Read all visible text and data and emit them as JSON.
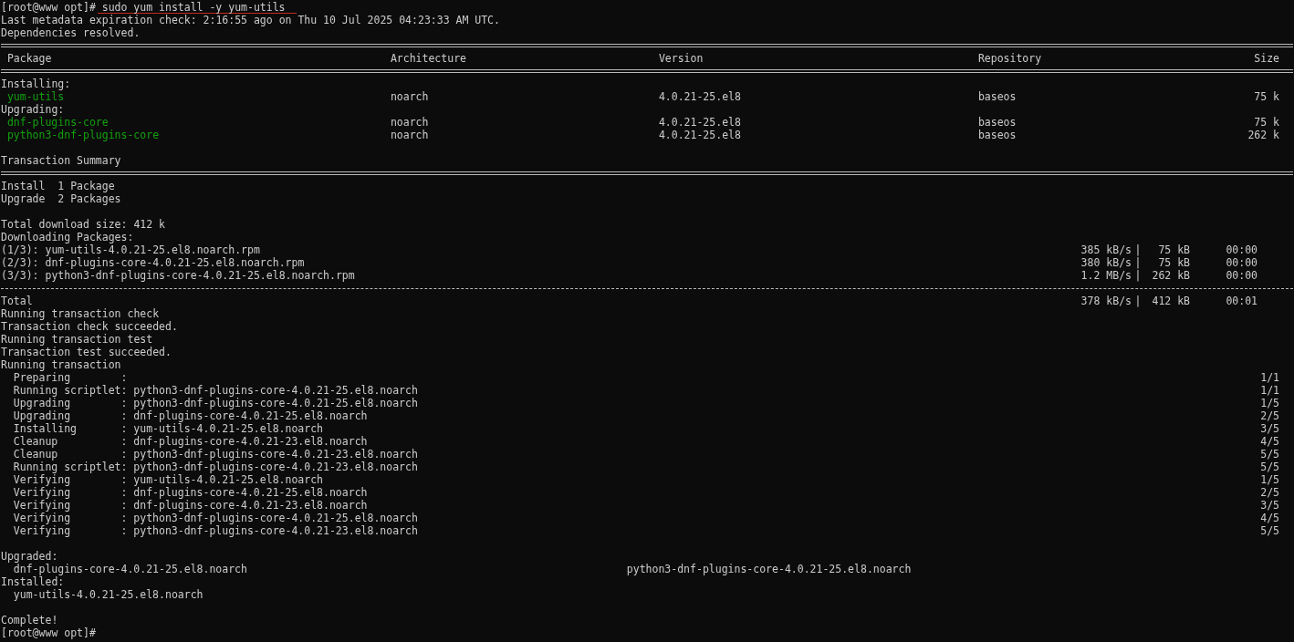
{
  "terminal": {
    "lines": [
      {
        "kind": "prompt",
        "prompt": "[root@www opt]#",
        "command": "sudo yum install -y yum-utils",
        "underlined": true
      },
      {
        "kind": "text",
        "text": "Last metadata expiration check: 2:16:55 ago on Thu 10 Jul 2025 04:23:33 AM UTC."
      },
      {
        "kind": "text",
        "text": "Dependencies resolved."
      },
      {
        "kind": "rule-double"
      },
      {
        "kind": "header",
        "cells": [
          "Package",
          "Architecture",
          "Version",
          "Repository",
          "Size"
        ]
      },
      {
        "kind": "rule-double"
      },
      {
        "kind": "text",
        "text": "Installing:"
      },
      {
        "kind": "package",
        "color": "#13a10e",
        "cells": [
          "yum-utils",
          "noarch",
          "4.0.21-25.el8",
          "baseos",
          "75 k"
        ]
      },
      {
        "kind": "text",
        "text": "Upgrading:"
      },
      {
        "kind": "package",
        "color": "#13a10e",
        "cells": [
          "dnf-plugins-core",
          "noarch",
          "4.0.21-25.el8",
          "baseos",
          "75 k"
        ]
      },
      {
        "kind": "package",
        "color": "#13a10e",
        "cells": [
          "python3-dnf-plugins-core",
          "noarch",
          "4.0.21-25.el8",
          "baseos",
          "262 k"
        ]
      },
      {
        "kind": "blank"
      },
      {
        "kind": "text",
        "text": "Transaction Summary"
      },
      {
        "kind": "rule-double"
      },
      {
        "kind": "text",
        "text": "Install  1 Package"
      },
      {
        "kind": "text",
        "text": "Upgrade  2 Packages"
      },
      {
        "kind": "blank"
      },
      {
        "kind": "text",
        "text": "Total download size: 412 k"
      },
      {
        "kind": "text",
        "text": "Downloading Packages:"
      },
      {
        "kind": "download",
        "label": "(1/3): yum-utils-4.0.21-25.el8.noarch.rpm",
        "rate": "385 kB/s",
        "sep": "|",
        "size": "75 kB",
        "time": "00:00"
      },
      {
        "kind": "download",
        "label": "(2/3): dnf-plugins-core-4.0.21-25.el8.noarch.rpm",
        "rate": "380 kB/s",
        "sep": "|",
        "size": "75 kB",
        "time": "00:00"
      },
      {
        "kind": "download",
        "label": "(3/3): python3-dnf-plugins-core-4.0.21-25.el8.noarch.rpm",
        "rate": "1.2 MB/s",
        "sep": "|",
        "size": "262 kB",
        "time": "00:00"
      },
      {
        "kind": "rule-single"
      },
      {
        "kind": "download",
        "label": "Total",
        "rate": "378 kB/s",
        "sep": "|",
        "size": "412 kB",
        "time": "00:01"
      },
      {
        "kind": "text",
        "text": "Running transaction check"
      },
      {
        "kind": "text",
        "text": "Transaction check succeeded."
      },
      {
        "kind": "text",
        "text": "Running transaction test"
      },
      {
        "kind": "text",
        "text": "Transaction test succeeded."
      },
      {
        "kind": "text",
        "text": "Running transaction"
      },
      {
        "kind": "step",
        "action": "Preparing        :",
        "progress": "1/1"
      },
      {
        "kind": "step",
        "action": "Running scriptlet:",
        "target": "python3-dnf-plugins-core-4.0.21-25.el8.noarch",
        "progress": "1/1"
      },
      {
        "kind": "step",
        "action": "Upgrading        :",
        "target": "python3-dnf-plugins-core-4.0.21-25.el8.noarch",
        "progress": "1/5"
      },
      {
        "kind": "step",
        "action": "Upgrading        :",
        "target": "dnf-plugins-core-4.0.21-25.el8.noarch",
        "progress": "2/5"
      },
      {
        "kind": "step",
        "action": "Installing       :",
        "target": "yum-utils-4.0.21-25.el8.noarch",
        "progress": "3/5"
      },
      {
        "kind": "step",
        "action": "Cleanup          :",
        "target": "dnf-plugins-core-4.0.21-23.el8.noarch",
        "progress": "4/5"
      },
      {
        "kind": "step",
        "action": "Cleanup          :",
        "target": "python3-dnf-plugins-core-4.0.21-23.el8.noarch",
        "progress": "5/5"
      },
      {
        "kind": "step",
        "action": "Running scriptlet:",
        "target": "python3-dnf-plugins-core-4.0.21-23.el8.noarch",
        "progress": "5/5"
      },
      {
        "kind": "step",
        "action": "Verifying        :",
        "target": "yum-utils-4.0.21-25.el8.noarch",
        "progress": "1/5"
      },
      {
        "kind": "step",
        "action": "Verifying        :",
        "target": "dnf-plugins-core-4.0.21-25.el8.noarch",
        "progress": "2/5"
      },
      {
        "kind": "step",
        "action": "Verifying        :",
        "target": "dnf-plugins-core-4.0.21-23.el8.noarch",
        "progress": "3/5"
      },
      {
        "kind": "step",
        "action": "Verifying        :",
        "target": "python3-dnf-plugins-core-4.0.21-25.el8.noarch",
        "progress": "4/5"
      },
      {
        "kind": "step",
        "action": "Verifying        :",
        "target": "python3-dnf-plugins-core-4.0.21-23.el8.noarch",
        "progress": "5/5"
      },
      {
        "kind": "blank"
      },
      {
        "kind": "text",
        "text": "Upgraded:"
      },
      {
        "kind": "columns",
        "items": [
          "dnf-plugins-core-4.0.21-25.el8.noarch",
          "python3-dnf-plugins-core-4.0.21-25.el8.noarch"
        ]
      },
      {
        "kind": "text",
        "text": "Installed:"
      },
      {
        "kind": "columns",
        "items": [
          "yum-utils-4.0.21-25.el8.noarch"
        ]
      },
      {
        "kind": "blank"
      },
      {
        "kind": "text",
        "text": "Complete!"
      },
      {
        "kind": "prompt",
        "prompt": "[root@www opt]#"
      }
    ]
  }
}
